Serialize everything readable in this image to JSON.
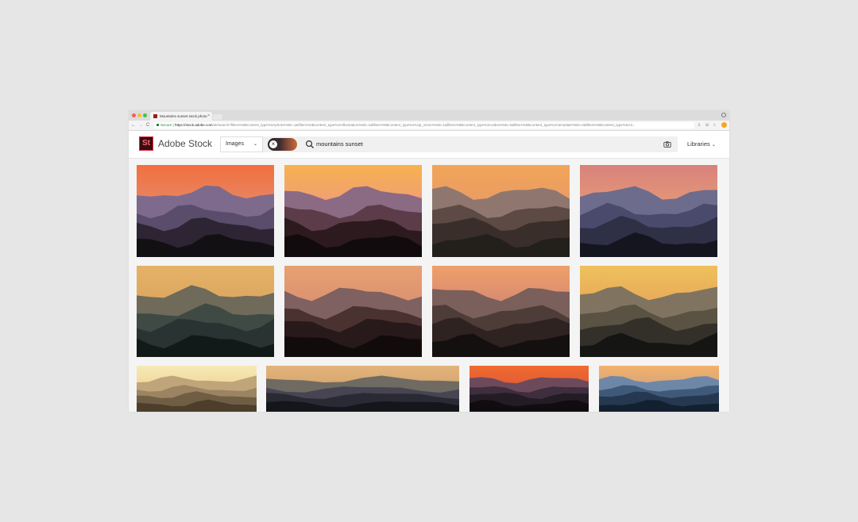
{
  "browser": {
    "tab_title": "Mountains sunset stock photo",
    "tab_close": "×",
    "nav": {
      "back": "←",
      "forward": "→",
      "reload": "C"
    },
    "url_secure": "Secure",
    "url_sep": " | ",
    "url_host": "https://stock.adobe.com",
    "url_path": "/uk/search?filters%5Bcontent_type%3Aphoto%5D=1&filters%5Bcontent_type%3Aillustration%5D=1&filters%5Bcontent_type%3Azip_vector%5D=1&filters%5Bcontent_type%3Avideo%5D=0&filters%5Bcontent_type%3Atemplate%5D=0&filters%5Bcontent_type%3A3..."
  },
  "header": {
    "logo_text": "St",
    "brand": "Adobe Stock",
    "filter_label": "Images",
    "filter_chevron": "⌄",
    "visual_clear": "×",
    "search_query": "mountains sunset",
    "libraries_label": "Libraries",
    "libraries_chevron": "⌄"
  },
  "icons": {
    "search": "search-icon",
    "camera": "camera-icon",
    "close": "close-icon",
    "chevron": "chevron-down-icon"
  },
  "colors": {
    "brand_dark": "#3d0b10",
    "brand_accent": "#e2283f",
    "secure_green": "#1e8e3e"
  },
  "results": [
    {
      "sky": [
        "#f26f3e",
        "#e58b6a",
        "#a66f8a"
      ],
      "hills": [
        "#7e6a8d",
        "#5a4c6b",
        "#2d2533",
        "#121013"
      ]
    },
    {
      "sky": [
        "#f7b24e",
        "#ee9a7e",
        "#c98da0"
      ],
      "hills": [
        "#8b6a83",
        "#5c3c48",
        "#2c1a1f",
        "#120b0d"
      ]
    },
    {
      "sky": [
        "#f2a557",
        "#e79a68",
        "#b98580"
      ],
      "hills": [
        "#8f776f",
        "#5d4a45",
        "#3a2e2b",
        "#23201c"
      ]
    },
    {
      "sky": [
        "#d8827b",
        "#e69a78",
        "#b291a2"
      ],
      "hills": [
        "#6d6c8d",
        "#4a4b6c",
        "#2f3045",
        "#151520"
      ]
    },
    {
      "sky": [
        "#e5b267",
        "#d9a45f",
        "#b49b72"
      ],
      "hills": [
        "#6f6a5a",
        "#3f4a44",
        "#283332",
        "#121919"
      ]
    },
    {
      "sky": [
        "#e8a072",
        "#d88f6f",
        "#a47a70"
      ],
      "hills": [
        "#7e6160",
        "#4a3230",
        "#28191a",
        "#120b0c"
      ]
    },
    {
      "sky": [
        "#f0a06a",
        "#d08671",
        "#9e7170"
      ],
      "hills": [
        "#7a5f5a",
        "#4e3c38",
        "#2e2321",
        "#151010"
      ]
    },
    {
      "sky": [
        "#eec15b",
        "#e6a55a",
        "#b58c6a"
      ],
      "hills": [
        "#807460",
        "#5a5242",
        "#33302a",
        "#151514"
      ]
    },
    {
      "sky": [
        "#f7eab6",
        "#efd597",
        "#d9b67f"
      ],
      "hills": [
        "#c0a57a",
        "#9c8462",
        "#6f5e44",
        "#4d3e2c"
      ]
    },
    {
      "sky": [
        "#e3b47b",
        "#d4a46e",
        "#a6906f"
      ],
      "hills": [
        "#6f6a62",
        "#474552",
        "#2a2a35",
        "#15151c"
      ]
    },
    {
      "sky": [
        "#f26b2f",
        "#de5a37",
        "#8e4b53"
      ],
      "hills": [
        "#6d4a5b",
        "#3f2e3d",
        "#241c25",
        "#100c10"
      ]
    },
    {
      "sky": [
        "#f4b26a",
        "#d1a27f",
        "#9aa6b8"
      ],
      "hills": [
        "#6f87a6",
        "#3f5979",
        "#253850",
        "#122030"
      ]
    }
  ]
}
